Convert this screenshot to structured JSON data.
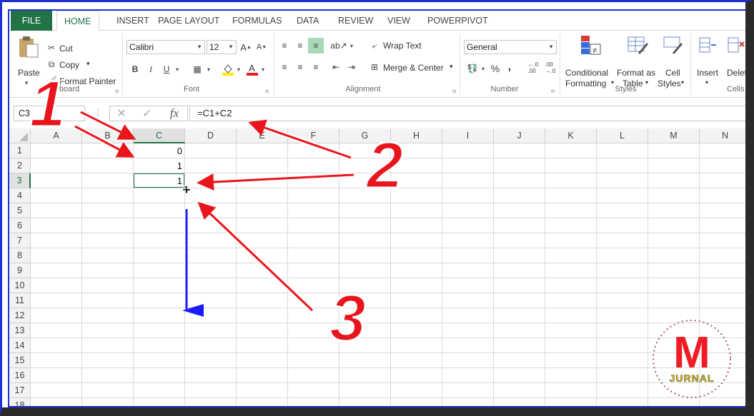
{
  "tabs": [
    "FILE",
    "HOME",
    "INSERT",
    "PAGE LAYOUT",
    "FORMULAS",
    "DATA",
    "REVIEW",
    "VIEW",
    "POWERPIVOT"
  ],
  "clipboard": {
    "paste": "Paste",
    "cut": "Cut",
    "copy": "Copy",
    "format_painter": "Format Painter",
    "label": "board"
  },
  "font": {
    "name": "Calibri",
    "size": "12",
    "bold": "B",
    "italic": "I",
    "underline": "U",
    "label": "Font"
  },
  "alignment": {
    "wrap": "Wrap Text",
    "merge": "Merge & Center",
    "label": "Alignment"
  },
  "number": {
    "format": "General",
    "percent": "%",
    "comma": ",",
    "label": "Number"
  },
  "styles": {
    "conditional_1": "Conditional",
    "conditional_2": "Formatting",
    "format_table_1": "Format as",
    "format_table_2": "Table",
    "cell_styles_1": "Cell",
    "cell_styles_2": "Styles",
    "label": "Styles"
  },
  "cells_group": {
    "insert": "Insert",
    "delete": "Delete",
    "label": "Cells"
  },
  "formula_bar": {
    "name_box": "C3",
    "fx": "fx",
    "formula": "=C1+C2"
  },
  "columns": [
    "A",
    "B",
    "C",
    "D",
    "E",
    "F",
    "G",
    "H",
    "I",
    "J",
    "K",
    "L",
    "M",
    "N"
  ],
  "rows": [
    "1",
    "2",
    "3",
    "4",
    "5",
    "6",
    "7",
    "8",
    "9",
    "10",
    "11",
    "12",
    "13",
    "14",
    "15",
    "16",
    "17",
    "18"
  ],
  "cells": {
    "C1": "0",
    "C2": "1",
    "C3": "1"
  },
  "annotations": {
    "n1": "1",
    "n2": "2",
    "n3": "3"
  },
  "logo": {
    "letter": "M",
    "word": "JURNAL"
  },
  "colors": {
    "excel_green": "#217346",
    "arrow_red": "#e8161c",
    "arrow_blue": "#1a1aff",
    "frame_blue": "#1f2fd6"
  }
}
